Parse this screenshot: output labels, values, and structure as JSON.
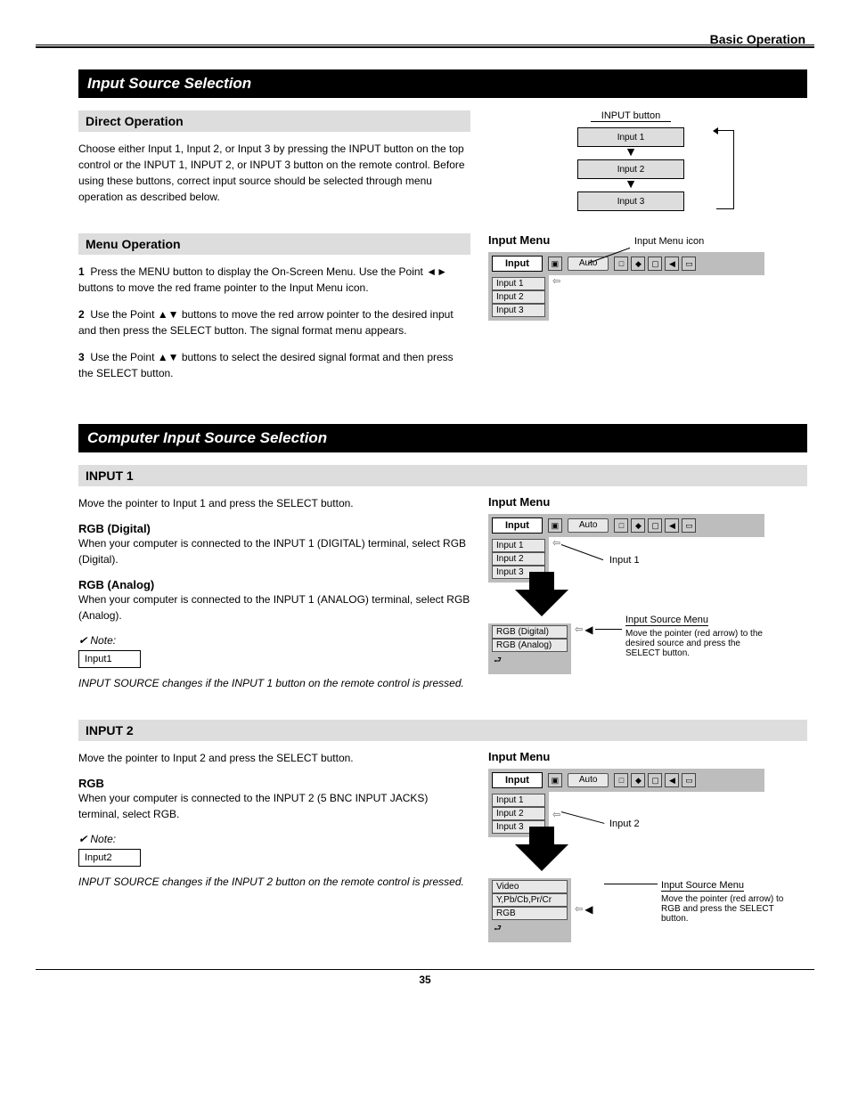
{
  "header": {
    "section_title": "Basic Operation"
  },
  "bar1": {
    "title": "Input Source Selection"
  },
  "sec1a": {
    "heading": "Direct Operation",
    "body": "Choose either Input 1, Input 2, or Input 3 by pressing the INPUT button on the top control or the INPUT 1, INPUT 2, or INPUT 3 button on the remote control. Before using these buttons, correct input source should be selected through menu operation as described below.",
    "flow_label": "INPUT button",
    "flow_items": [
      "Input 1",
      "Input 2",
      "Input 3"
    ]
  },
  "sec1b": {
    "heading": "Menu Operation",
    "steps": [
      "Press the MENU button to display the On-Screen Menu. Use the Point ◄► buttons to move the red frame pointer to the Input Menu icon.",
      "Use the Point ▲▼ buttons to move the red arrow pointer to the desired input and then press the SELECT button. The signal format menu appears.",
      "Use the Point ▲▼ buttons to select the desired signal format and then press the SELECT button."
    ],
    "menu_title": "Input Menu",
    "menu_box": "Input",
    "pill": "Auto",
    "items": [
      "Input 1",
      "Input 2",
      "Input 3"
    ],
    "callout": "Input Menu icon"
  },
  "bar2": {
    "title": "Computer Input Source Selection"
  },
  "secInput1": {
    "heading": "INPUT 1",
    "intro": "Move the pointer to Input 1 and press the SELECT button.",
    "rgb_digital_label": "RGB (Digital)",
    "rgb_digital_body": "When your computer is connected to the INPUT 1 (DIGITAL) terminal, select RGB (Digital).",
    "rgb_analog_label": "RGB (Analog)",
    "rgb_analog_body": "When your computer is connected to the INPUT 1 (ANALOG) terminal, select RGB (Analog).",
    "note_label": "✔ Note:",
    "note1": "INPUT SOURCE changes if the INPUT 1 button on the remote control is pressed.",
    "menu_title": "Input Menu",
    "menu_box": "Input",
    "pill": "Auto",
    "items": [
      "Input 1",
      "Input 2",
      "Input 3"
    ],
    "callout_top": "Input 1",
    "sub_items": [
      "RGB (Digital)",
      "RGB (Analog)"
    ],
    "sub_label": "Input Source Menu",
    "sub_callout": "Move the pointer (red arrow) to the desired source and press the SELECT button."
  },
  "secInput2": {
    "heading": "INPUT 2",
    "intro": "Move the pointer to Input 2 and press the SELECT button.",
    "rgb_label": "RGB",
    "rgb_body": "When your computer is connected to the INPUT 2 (5 BNC INPUT JACKS) terminal, select RGB.",
    "note_label": "✔ Note:",
    "note1": "INPUT SOURCE changes if the INPUT 2 button on the remote control is pressed.",
    "menu_title": "Input Menu",
    "menu_box": "Input",
    "pill": "Auto",
    "items": [
      "Input 1",
      "Input 2",
      "Input 3"
    ],
    "callout_top": "Input 2",
    "sub_items": [
      "Video",
      "Y,Pb/Cb,Pr/Cr",
      "RGB"
    ],
    "sub_label": "Input Source Menu",
    "sub_callout": "Move the pointer (red arrow) to RGB and press the SELECT button."
  },
  "footer": {
    "page": "35"
  }
}
